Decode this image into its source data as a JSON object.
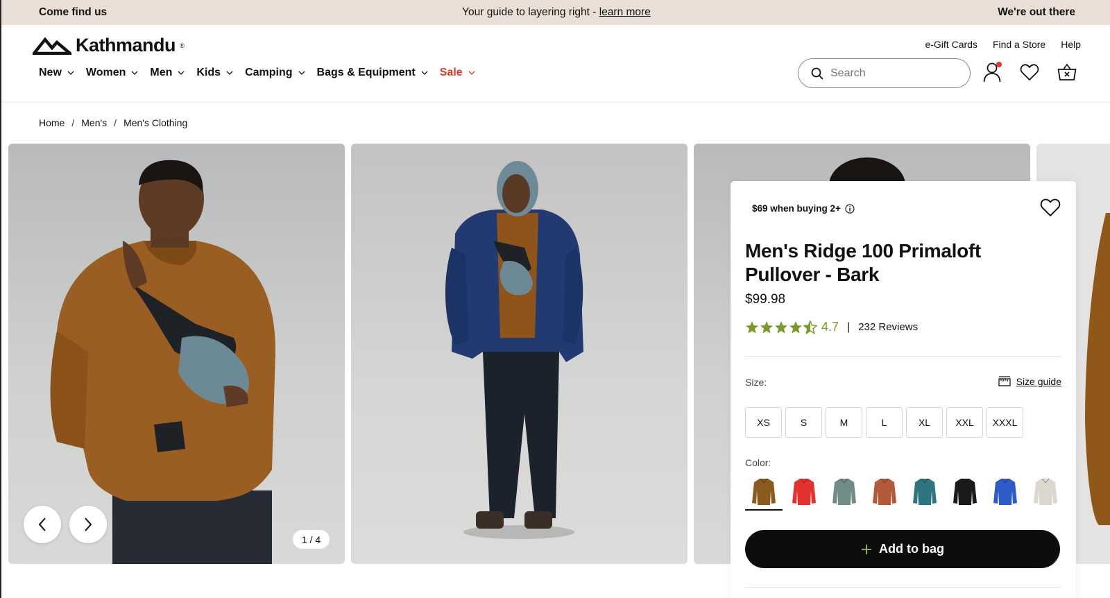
{
  "announcement": {
    "left": "Come find us",
    "middle": "Your guide to layering right - ",
    "middle_link": "learn more",
    "right": "We're out there"
  },
  "brand": {
    "name": "Kathmandu",
    "reg": "®"
  },
  "utility_links": [
    "e-Gift Cards",
    "Find a Store",
    "Help"
  ],
  "nav": [
    {
      "label": "New"
    },
    {
      "label": "Women"
    },
    {
      "label": "Men"
    },
    {
      "label": "Kids"
    },
    {
      "label": "Camping"
    },
    {
      "label": "Bags & Equipment"
    },
    {
      "label": "Sale"
    }
  ],
  "search": {
    "placeholder": "Search"
  },
  "header_icons": [
    "account-icon",
    "wishlist-icon",
    "basket-icon"
  ],
  "breadcrumb": [
    "Home",
    "Men's",
    "Men's Clothing"
  ],
  "gallery": {
    "counter": "1 / 4"
  },
  "product": {
    "promo": "$69 when buying 2+",
    "title": "Men's Ridge 100 Primaloft Pullover - Bark",
    "price": "$99.98",
    "rating": 4.7,
    "rating_text": "4.7",
    "reviews": "232 Reviews",
    "size_label": "Size:",
    "size_guide": "Size guide",
    "sizes": [
      "XS",
      "S",
      "M",
      "L",
      "XL",
      "XXL",
      "XXXL"
    ],
    "color_label": "Color:",
    "colors": [
      {
        "name": "bark",
        "hex": "#8a5a1e",
        "selected": true
      },
      {
        "name": "red",
        "hex": "#e2312f"
      },
      {
        "name": "sage",
        "hex": "#6f8c86"
      },
      {
        "name": "rust",
        "hex": "#b35a3a"
      },
      {
        "name": "teal",
        "hex": "#2e7580"
      },
      {
        "name": "black",
        "hex": "#1b1b1b"
      },
      {
        "name": "blue",
        "hex": "#2f5bc6"
      },
      {
        "name": "ecru",
        "hex": "#dcd8cf"
      }
    ],
    "add_to_bag": "Add to bag"
  },
  "colors": {
    "sale": "#d93a23",
    "star": "#7a9a2a",
    "announce_bg": "#e9dfd6"
  }
}
